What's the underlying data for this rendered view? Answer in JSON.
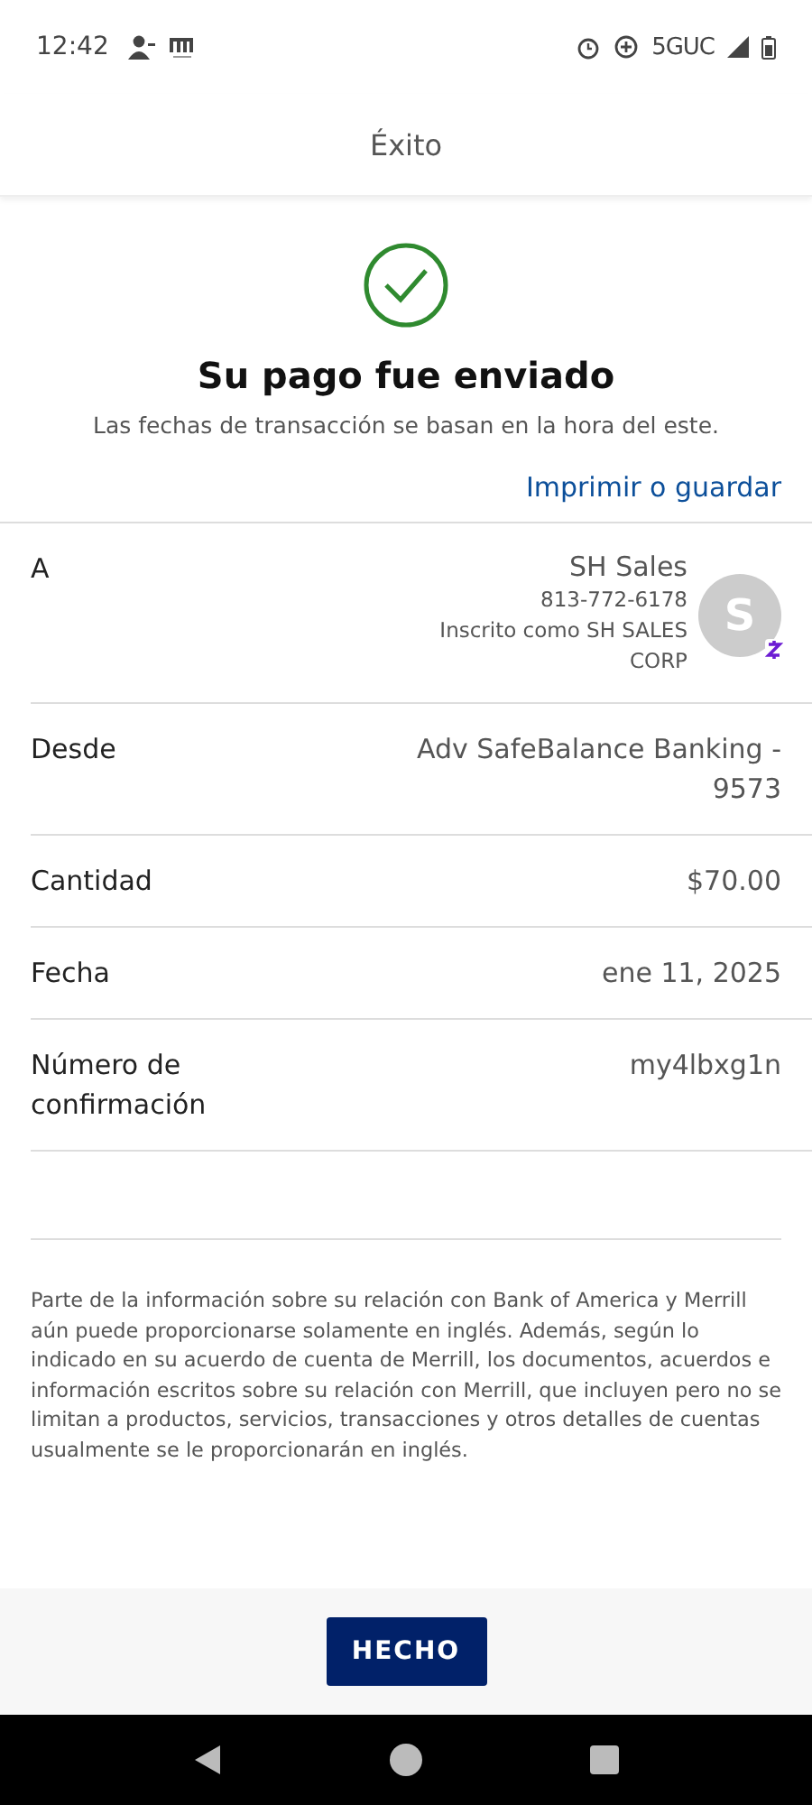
{
  "status_bar": {
    "time": "12:42",
    "network": "5GUC"
  },
  "header": {
    "title": "Éxito"
  },
  "confirmation": {
    "title": "Su pago fue enviado",
    "subtitle": "Las fechas de transacción se basan en la hora del este.",
    "print_link": "Imprimir o guardar"
  },
  "details": [
    {
      "kind": "recipient",
      "label": "A",
      "name": "SH Sales",
      "phone": "813-772-6178",
      "enrolled": "Inscrito como SH SALES CORP",
      "avatar": "S"
    },
    {
      "kind": "plain",
      "label": "Desde",
      "value": "Adv SafeBalance Banking - 9573"
    },
    {
      "kind": "plain",
      "label": "Cantidad",
      "value": "$70.00"
    },
    {
      "kind": "plain",
      "label": "Fecha",
      "value": "ene 11, 2025"
    },
    {
      "kind": "plain",
      "label": "Número de confirmación",
      "value": "my4lbxg1n"
    }
  ],
  "disclaimer": "Parte de la información sobre su relación con Bank of America y Merrill aún puede proporcionarse solamente en inglés. Además, según lo indicado en su acuerdo de cuenta de Merrill, los documentos, acuerdos e información escritos sobre su relación con Merrill, que incluyen pero no se limitan a productos, servicios, transacciones y otros detalles de cuentas usualmente se le proporcionarán en inglés.",
  "done_button": "HECHO"
}
